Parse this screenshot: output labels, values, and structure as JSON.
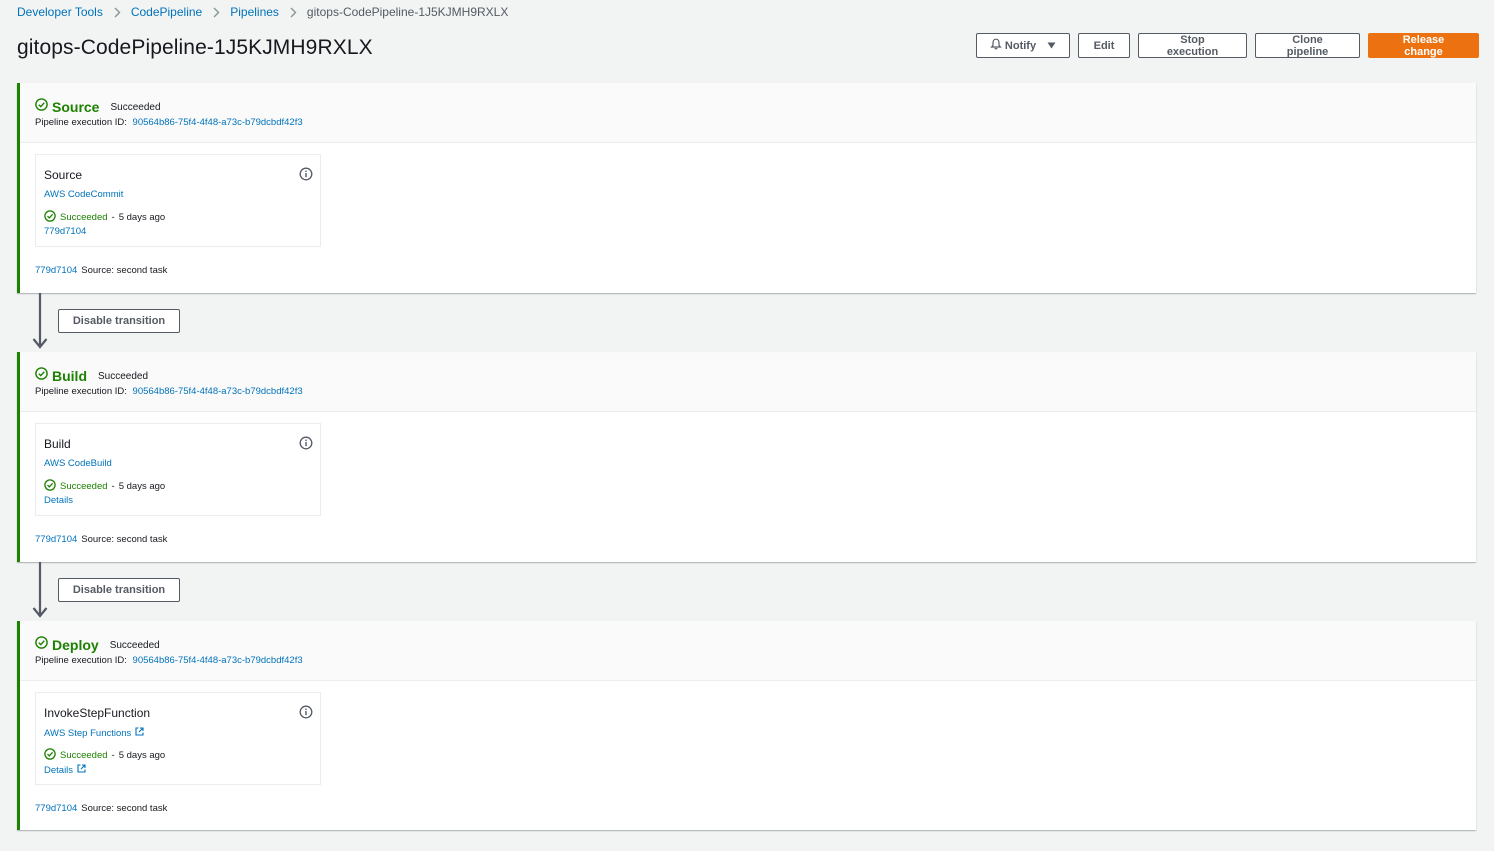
{
  "breadcrumb": {
    "items": [
      "Developer Tools",
      "CodePipeline",
      "Pipelines"
    ],
    "current": "gitops-CodePipeline-1J5KJMH9RXLX"
  },
  "page": {
    "title": "gitops-CodePipeline-1J5KJMH9RXLX"
  },
  "actions": {
    "notify": "Notify",
    "edit": "Edit",
    "stop": "Stop execution",
    "clone": "Clone pipeline",
    "release": "Release change"
  },
  "transitions": {
    "first": "Disable transition",
    "second": "Disable transition"
  },
  "stages": [
    {
      "name": "Source",
      "status": "Succeeded",
      "exec_label": "Pipeline execution ID:",
      "exec_id": "90564b86-75f4-4f48-a73c-b79dcbdf42f3",
      "action": {
        "name": "Source",
        "provider": "AWS CodeCommit",
        "status": "Succeeded",
        "age": "5 days ago",
        "link": "779d7104"
      },
      "commit_id": "779d7104",
      "commit_msg": "Source: second task"
    },
    {
      "name": "Build",
      "status": "Succeeded",
      "exec_label": "Pipeline execution ID:",
      "exec_id": "90564b86-75f4-4f48-a73c-b79dcbdf42f3",
      "action": {
        "name": "Build",
        "provider": "AWS CodeBuild",
        "status": "Succeeded",
        "age": "5 days ago",
        "link": "Details"
      },
      "commit_id": "779d7104",
      "commit_msg": "Source: second task"
    },
    {
      "name": "Deploy",
      "status": "Succeeded",
      "exec_label": "Pipeline execution ID:",
      "exec_id": "90564b86-75f4-4f48-a73c-b79dcbdf42f3",
      "action": {
        "name": "InvokeStepFunction",
        "provider": "AWS Step Functions",
        "status": "Succeeded",
        "age": "5 days ago",
        "link": "Details"
      },
      "commit_id": "779d7104",
      "commit_msg": "Source: second task"
    }
  ],
  "colors": {
    "success": "#1d8102",
    "link": "#0073bb",
    "primary": "#ec7211"
  },
  "icons": {
    "status": "check-circle-icon",
    "info": "info-icon",
    "external": "external-link-icon",
    "notify": "bell-icon",
    "caret": "caret-down-icon",
    "breadcrumb_sep": "chevron-right-icon"
  }
}
